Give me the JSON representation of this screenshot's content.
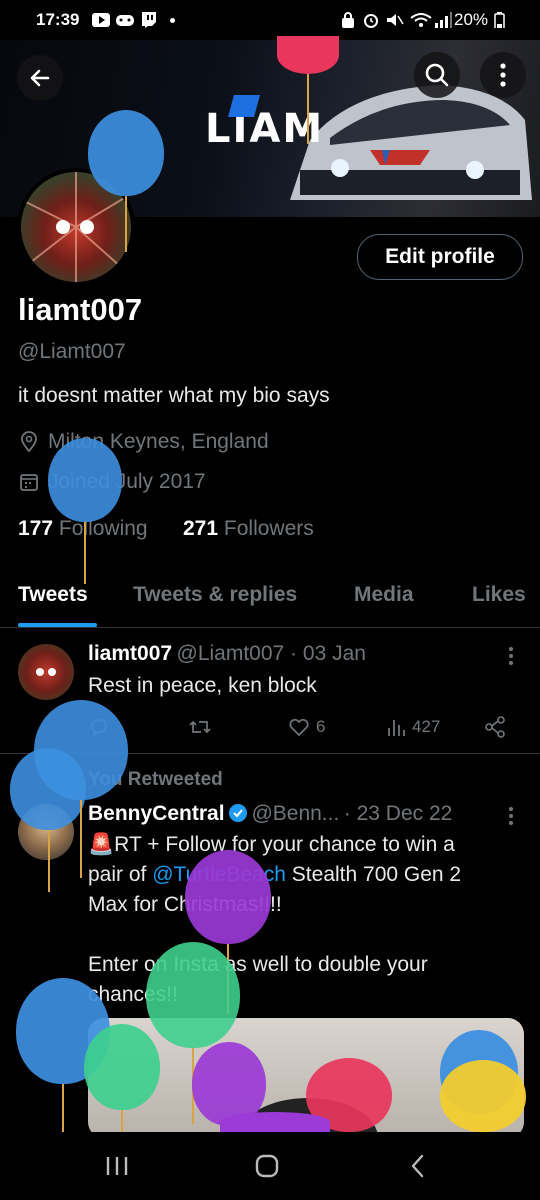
{
  "status_bar": {
    "time": "17:39",
    "battery": "20%"
  },
  "banner": {
    "logo_text": "LIAM"
  },
  "profile": {
    "edit_label": "Edit profile",
    "name": "liamt007",
    "handle": "@Liamt007",
    "bio": "it doesnt matter what my bio says",
    "location": "Milton Keynes, England",
    "joined": "Joined July 2017",
    "following_count": "177",
    "following_label": "Following",
    "followers_count": "271",
    "followers_label": "Followers"
  },
  "tabs": [
    {
      "label": "Tweets"
    },
    {
      "label": "Tweets & replies"
    },
    {
      "label": "Media"
    },
    {
      "label": "Likes"
    }
  ],
  "tweets": [
    {
      "name": "liamt007",
      "handle_time": "@Liamt007 · 03 Jan",
      "text": "Rest in peace, ken block",
      "likes": "6",
      "views": "427"
    },
    {
      "retweet_label": "You Retweeted",
      "name": "BennyCentral",
      "handle": "@Benn...",
      "time": "· 23 Dec 22",
      "line1_emoji": "🚨",
      "line1": "RT + Follow for your chance to win a",
      "line2_pre": "pair of ",
      "line2_link": "@TurtleBeach",
      "line2_post": " Stealth 700 Gen 2",
      "line3": "Max for Christmas!!!!",
      "line4": "Enter on Insta as well to double your",
      "line5": "chances!!"
    }
  ],
  "colors": {
    "accent": "#1d9bf0",
    "background": "#000000",
    "muted": "#71767b"
  }
}
